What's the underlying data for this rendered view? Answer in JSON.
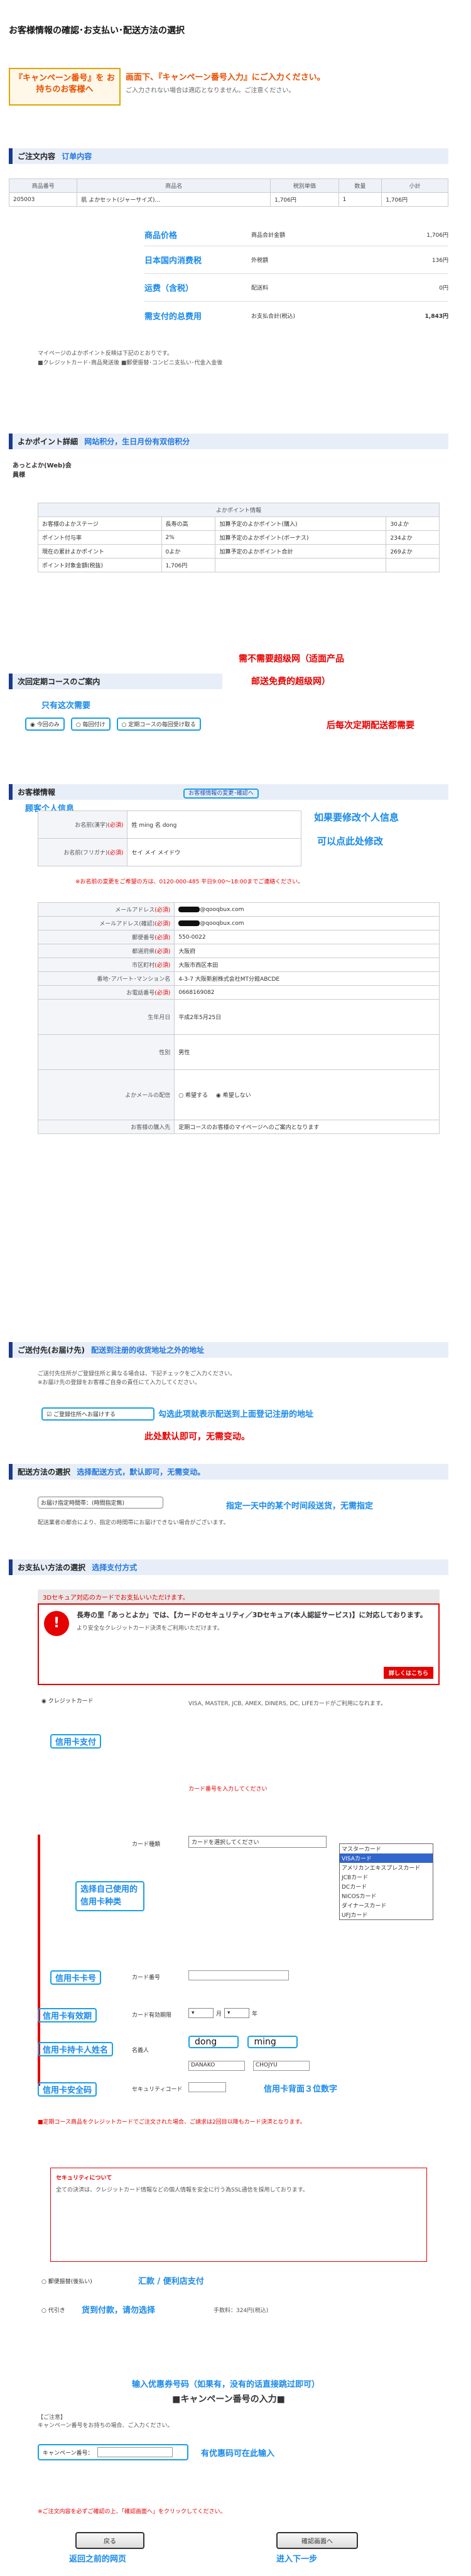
{
  "page": {
    "title": "お客様情報の確認･お支払い･配送方法の選択",
    "campaign_hint_left": "『キャンペーン番号』を お持ちのお客様へ",
    "campaign_hint_right_1": "画面下、『キャンペーン番号入力』にご入力ください。",
    "campaign_hint_right_2": "ご入力されない場合は適応となりません。ご注意ください。"
  },
  "order": {
    "head": "ご注文内容",
    "head_cn": "订单内容",
    "columns": [
      "商品番号",
      "商品名",
      "税別単価",
      "数量",
      "小計"
    ],
    "row": [
      "205003",
      "肌 よかセット(ジャーサイズ)…",
      "1,706円",
      "1",
      "1,706円"
    ],
    "subtotal_cn": "商品价格",
    "subtotal_label": "商品合計金額",
    "subtotal_value": "1,706円",
    "tax_cn": "日本国内消费税",
    "tax_label": "外税額",
    "tax_value": "136円",
    "ship_cn": "运费（含税）",
    "ship_label": "配送料",
    "ship_value": "0円",
    "total_cn": "需支付的总费用",
    "total_label": "お支払合計(税込)",
    "total_value": "1,843円",
    "note1": "マイページのよかポイント反映は下記のとおりです。",
    "note2": "■クレジットカード･商品発送後 ■郵便振替･コンビニ支払い･代金入金後"
  },
  "points": {
    "head": "よかポイント詳細",
    "head_cn": "网站积分，生日月份有双倍积分",
    "member_label": "あっとよか(Web)会員様",
    "table_head": "よかポイント情報",
    "rows": [
      [
        "お客様のよかステージ",
        "長寿の高",
        "加算予定のよかポイント(購入)",
        "30よか"
      ],
      [
        "ポイント付与率",
        "2%",
        "加算予定のよかポイント(ボーナス)",
        "234よか"
      ],
      [
        "現在の累計よかポイント",
        "0よか",
        "加算予定のよかポイント合計",
        "269よか"
      ],
      [
        "ポイント対象金額(税抜)",
        "1,706円",
        "",
        ""
      ]
    ]
  },
  "regular": {
    "head": "次回定期コースのご案内",
    "cn1": "需不需要超级网（适面产品",
    "cn2": "邮送免费的超级网）",
    "cn3": "只有这次需要",
    "cn4": "后每次定期配送都需要",
    "opt1": "今回のみ",
    "opt2": "毎回付け",
    "opt3": "定期コースの毎回受け取る"
  },
  "customer": {
    "head": "お客様情報",
    "change_link": "お客様情報の変更･確認へ",
    "cn_head": "顾客个人信息",
    "cn_change": "如果要修改个人信息",
    "cn_change2": "可以点此处修改",
    "name_label": "お名前(漢字)",
    "name_value": "姓 ming 名 dong",
    "kana_label": "お名前(フリガナ)",
    "kana_value": "セイ メイ メイドウ",
    "phone_note": "※お名前の変更をご希望の方は、0120-000-485 平日9:00～18:00までご連絡ください。",
    "email_label": "メールアドレス",
    "email_value": "@qooqbux.com",
    "email2_label": "メールアドレス(確認)",
    "email2_value": "@qooqbux.com",
    "zip_label": "郵便番号",
    "zip_value": "550-0022",
    "pref_label": "都道府県",
    "pref_value": "大阪府",
    "city_label": "市区町村",
    "city_value": "大阪市西区本田",
    "addr_label": "番地･アパート･マンション名",
    "addr_value": "4-3-7 大阪新創株式会社MT分館ABCDE",
    "tel_label": "お電話番号",
    "tel_value": "0668169082",
    "birth_label": "生年月日",
    "birth_value": "平成2年5月25日",
    "sex_label": "性別",
    "sex_value": "男性",
    "mail_label": "よかメールの配信",
    "mail_opt1": "希望する",
    "mail_opt2": "希望しない",
    "route_label": "お客様の購入先",
    "route_value": "定期コースのお客様のマイページへのご案内となります"
  },
  "shipping_addr": {
    "head": "ご送付先(お届け先)",
    "cn_head": "配送到注册的收货地址之外的地址",
    "note1": "ご送付先住所がご登録住所と異なる場合は、下記チェックをご入力ください。",
    "note2": "※お届け先の登録をお客様ご自身の責任にて入力してください。",
    "check_label": "ご登録住所へお届けする",
    "cn_check": "勾选此项就表示配送到上面登记注册的地址",
    "cn_check2": "此处默认即可，无需变动。"
  },
  "delivery": {
    "head": "配送方法の選択",
    "cn_head": "选择配送方式，默认即可，无需变动。",
    "select_label": "お届け日時指定",
    "select_value": "お届け指定時間帯：(時間指定無)",
    "cn_select": "指定一天中的某个时间段送货，无需指定",
    "note": "配送業者の都合により、指定の時間帯にお届けできない場合がございます。"
  },
  "payment": {
    "head": "お支払い方法の選択",
    "cn_head": "选择支付方式",
    "banner_text": "3Dセキュア対応のカードでお支払いいただけます。",
    "secure_title": "長寿の里「あっとよか」では、【カードのセキュリティ／3Dセキュア(本人認証サービス)】に対応しております。",
    "secure_sub": "より安全なクレジットカード決済をご利用いただけます。",
    "detail_btn": "詳しくはこちら",
    "cards_text": "VISA, MASTER, JCB, AMEX, DINERS, DC, LIFEカードがご利用になれます。",
    "credit_label": "クレジットカード",
    "cn_credit": "信用卡支付",
    "card_note": "カード番号を入力してください",
    "type_label": "カード種類",
    "cn_type": "选择自己使用的信用卡种类",
    "type_options": [
      "カードを選択してください",
      "マスターカード",
      "VISAカード",
      "アメリカンエキスプレスカード",
      "JCBカード",
      "DCカード",
      "NICOSカード",
      "ダイナースカード",
      "UFJカード"
    ],
    "type_selected": "VISAカード",
    "cn_number": "信用卡卡号",
    "number_label": "カード番号",
    "cn_expiry": "信用卡有效期",
    "expiry_label": "カード有効期限",
    "expiry_m": "月",
    "expiry_y": "年",
    "cn_holder": "信用卡持卡人姓名",
    "holder_label": "名義人",
    "holder_sei": "dong",
    "holder_mei": "ming",
    "holder_kana_sei": "DANAKO",
    "holder_kana_mei": "CHOJYU",
    "cn_cvc": "信用卡安全码",
    "cvc_label": "セキュリティコード",
    "cn_cvc2": "信用卡背面３位数字",
    "notes": "■定期コース商品をクレジットカードでご注文された場合、ご請求は2回目以降もカード決済となります。",
    "security_title": "セキュリティについて",
    "security_body": "全ての決済は、クレジットカード情報などの個人情報を安全に行う為SSL通信を採用しております。",
    "bank_label": "郵便振替(後払い)",
    "cn_bank": "汇款 / 便利店支付",
    "cod_label": "代引き",
    "cn_cod": "货到付款，请勿选择",
    "cod_note": "手数料：324円(税込)"
  },
  "campaign": {
    "cn_head": "输入优惠券号码（如果有，没有的话直接跳过即可）",
    "head": "■キャンペーン番号の入力■",
    "note_title": "【ご注意】",
    "note1": "キャンペーン番号をお持ちの場合、ご入力ください。",
    "input_label": "キャンペーン番号：",
    "cn_input": "有优惠码可在此输入"
  },
  "footer": {
    "warning": "※ご注文内容を必ずご確認の上、「確認画面へ」をクリックしてください。",
    "back_btn": "戻る",
    "confirm_btn": "確認画面へ",
    "cn_back": "返回之前的网页",
    "cn_next": "进入下一步"
  }
}
